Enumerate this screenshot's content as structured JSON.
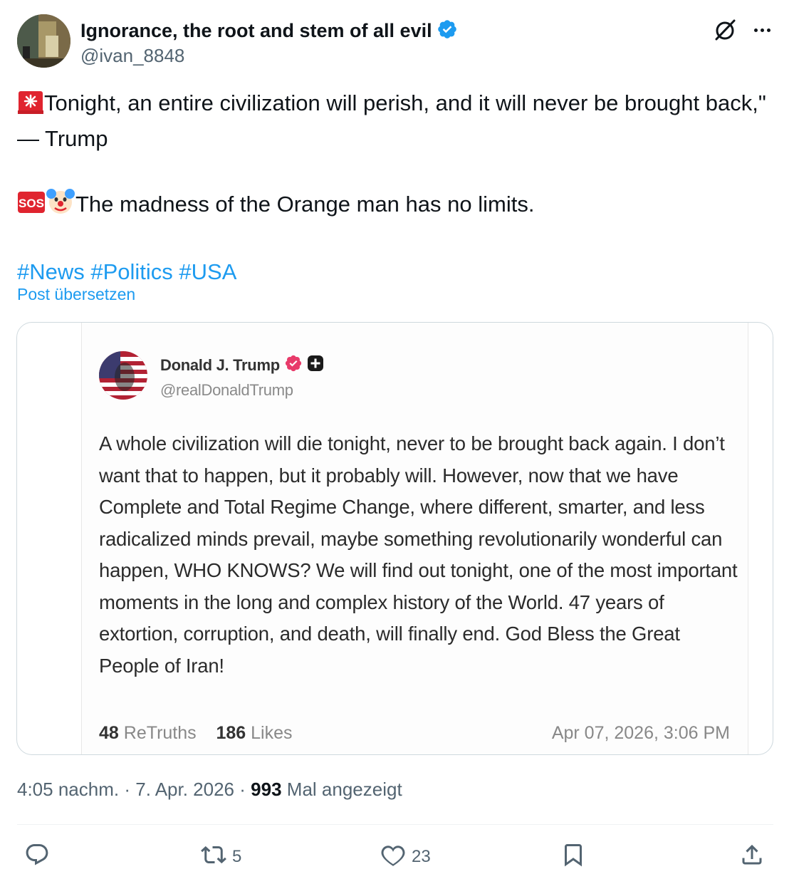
{
  "author": {
    "display_name": "Ignorance, the root and stem of all evil",
    "handle": "@ivan_8848",
    "verified_icon": "verified-badge-icon"
  },
  "post": {
    "line1": "Tonight, an entire civilization will perish, and it will never be brought back,\" — Trump",
    "line2": "The madness of the Orange man has no limits.",
    "hashtags": "#News #Politics #USA",
    "translate_label": "Post übersetzen"
  },
  "embedded_screenshot": {
    "name": "Donald J. Trump",
    "handle": "@realDonaldTrump",
    "body": "A whole civilization will die tonight, never to be brought back again. I don’t want that to happen, but it probably will. However, now that we have Complete and Total Regime Change, where different, smarter, and less radicalized minds prevail, maybe something revolutionarily wonderful can happen, WHO KNOWS? We will find out tonight, one of the most important moments in the long and complex history of the World. 47 years of extortion, corruption, and death, will finally end. God Bless the Great People of Iran!",
    "retruths_count": "48",
    "retruths_label": "ReTruths",
    "likes_count": "186",
    "likes_label": "Likes",
    "date": "Apr 07, 2026, 3:06 PM"
  },
  "meta": {
    "time": "4:05 nachm.",
    "separator": "·",
    "date": "7. Apr. 2026",
    "views_count": "993",
    "views_label": "Mal angezeigt"
  },
  "actions": {
    "reply_count": "",
    "repost_count": "5",
    "like_count": "23"
  },
  "colors": {
    "accent": "#1d9bf0",
    "text": "#0f1419",
    "muted": "#536471",
    "border": "#cfd9de"
  }
}
